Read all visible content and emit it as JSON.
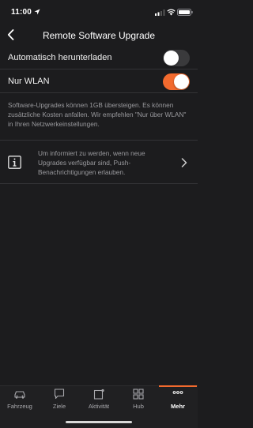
{
  "status_bar": {
    "time": "11:00"
  },
  "nav": {
    "title": "Remote Software Upgrade"
  },
  "settings": [
    {
      "label": "Automatisch herunterladen",
      "enabled": false
    },
    {
      "label": "Nur WLAN",
      "enabled": true
    }
  ],
  "info_text": "Software-Upgrades können 1GB übersteigen. Es können zusätzliche Kosten anfallen. Wir empfehlen \"Nur über WLAN\" in Ihren Netzwerkeinstellungen.",
  "notification": {
    "text": "Um informiert zu werden, wenn neue Upgrades verfügbar sind, Push-Benachrichtigungen erlauben."
  },
  "tabs": [
    {
      "label": "Fahrzeug",
      "icon": "car-icon"
    },
    {
      "label": "Ziele",
      "icon": "chat-icon"
    },
    {
      "label": "Aktivität",
      "icon": "activity-icon"
    },
    {
      "label": "Hub",
      "icon": "grid-icon"
    },
    {
      "label": "Mehr",
      "icon": "more-icon",
      "active": true
    }
  ],
  "colors": {
    "accent": "#f26a2e",
    "background": "#1c1c1e",
    "muted_text": "#9a9a9e"
  }
}
